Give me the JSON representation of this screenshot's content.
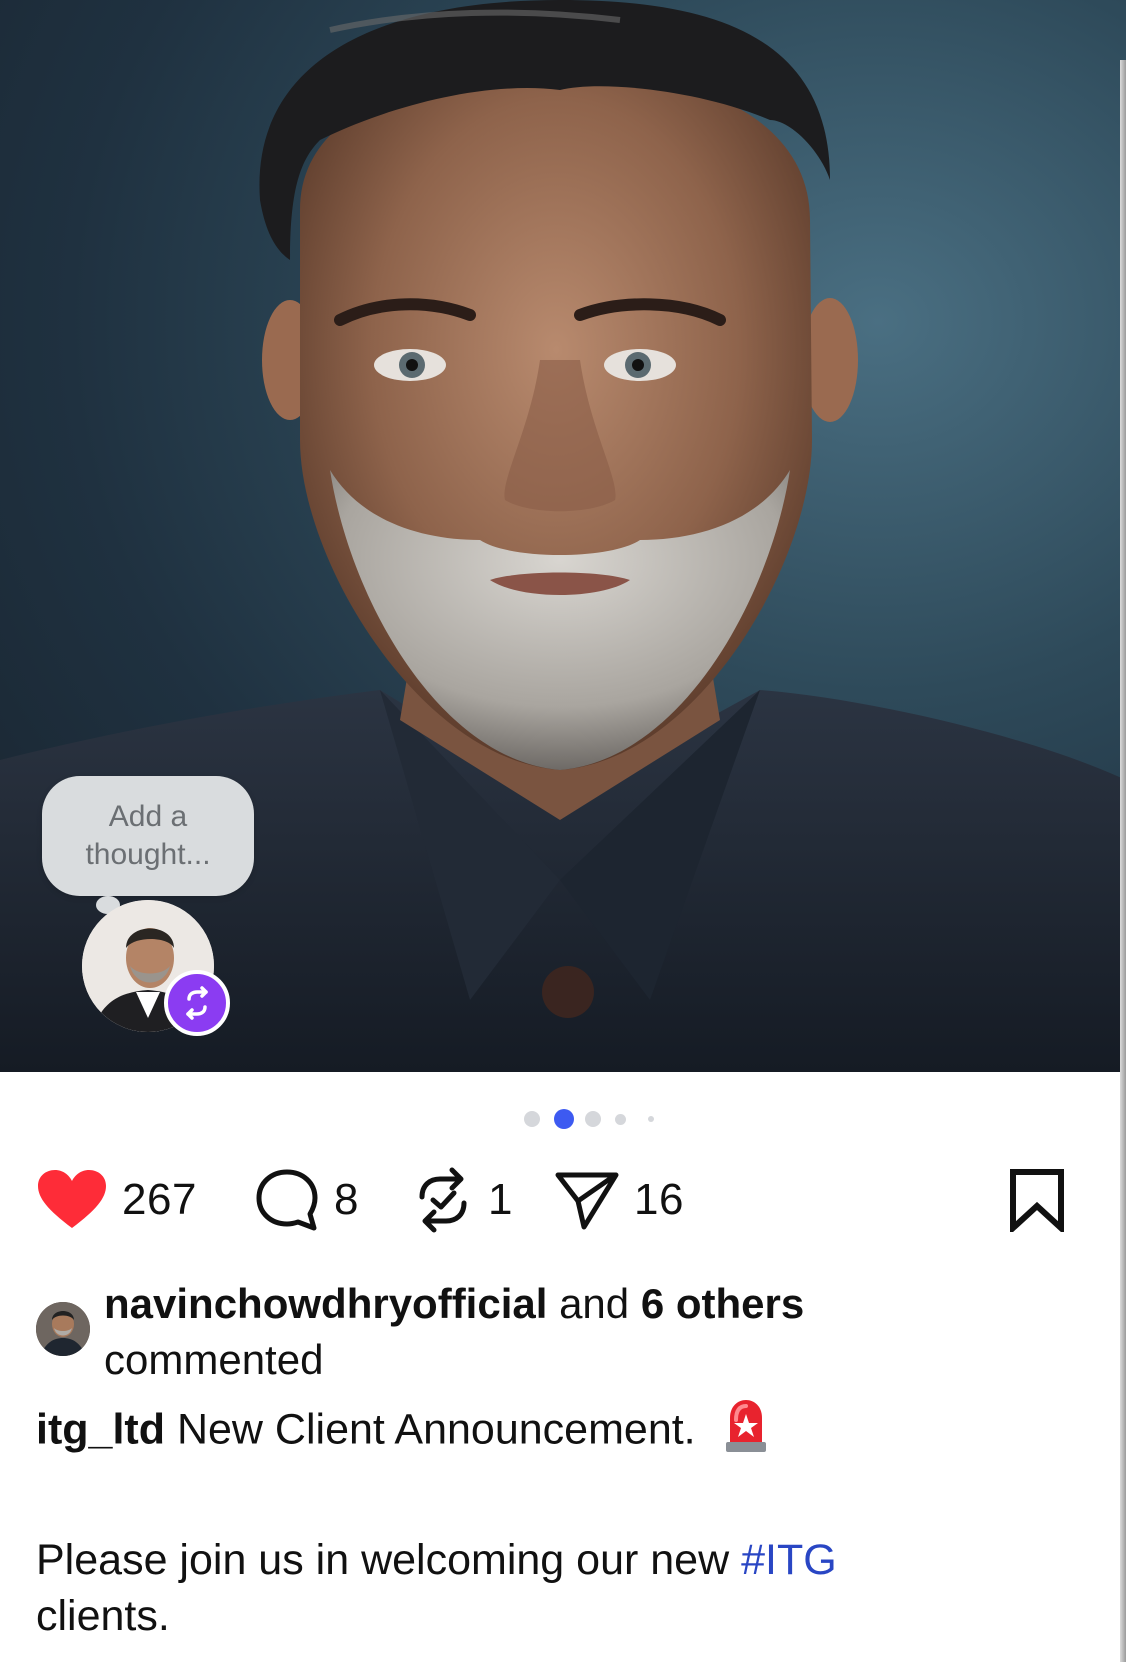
{
  "photo": {
    "alt_subject": "portrait-photo"
  },
  "thought_bubble": {
    "placeholder": "Add a thought..."
  },
  "carousel": {
    "total": 5,
    "active_index": 1
  },
  "actions": {
    "likes": "267",
    "comments": "8",
    "reposts": "1",
    "shares": "16"
  },
  "engagement": {
    "username": "navinchowdhryofficial",
    "connector": " and ",
    "others": "6 others",
    "suffix": " commented"
  },
  "caption": {
    "author": "itg_ltd",
    "headline": "New Client Announcement.",
    "body_prefix": "Please join us in welcoming our new ",
    "hashtag": "#ITG",
    "body_suffix": "clients."
  },
  "colors": {
    "like_red": "#fe2c38",
    "hashtag_blue": "#2946c4",
    "repost_purple": "#8b3cf2",
    "active_dot": "#3d5af1"
  }
}
